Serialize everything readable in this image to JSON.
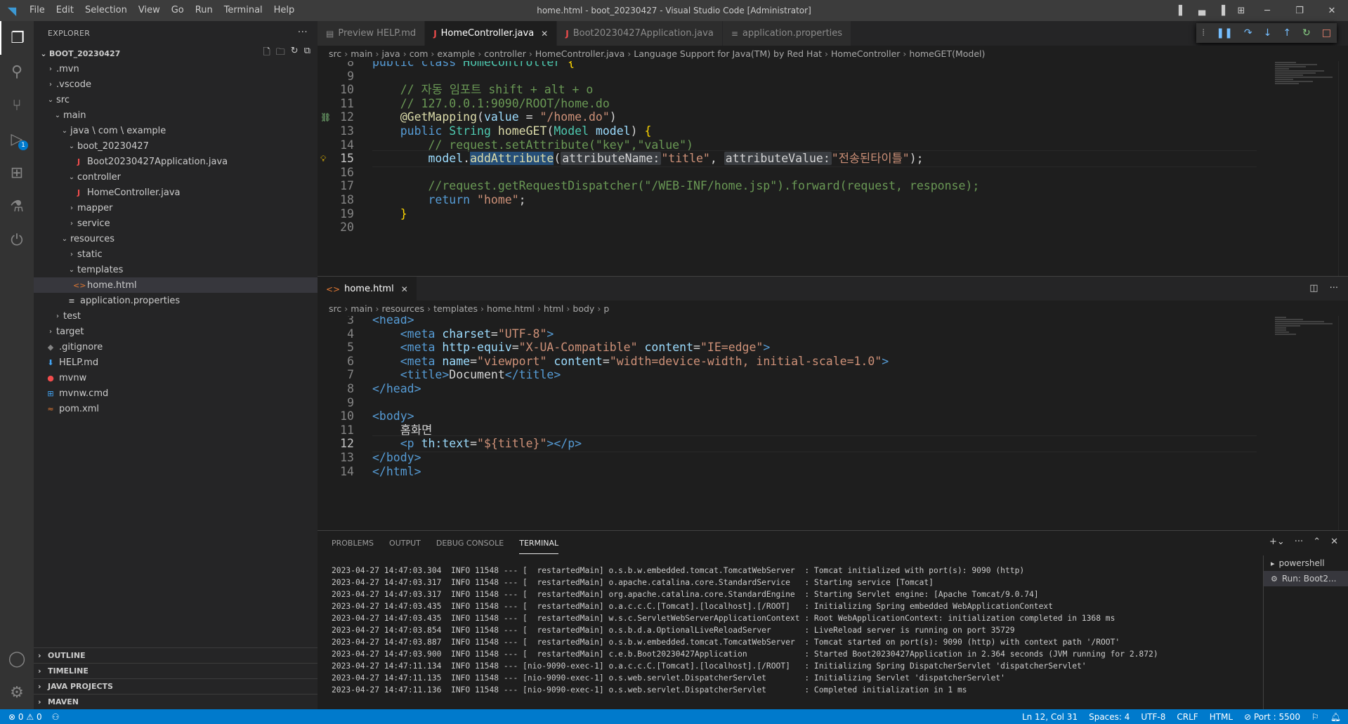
{
  "window": {
    "title": "home.html - boot_20230427 - Visual Studio Code [Administrator]",
    "menu": [
      "File",
      "Edit",
      "Selection",
      "View",
      "Go",
      "Run",
      "Terminal",
      "Help"
    ]
  },
  "activity": {
    "debug_badge": "1"
  },
  "sidebar": {
    "header": "EXPLORER",
    "root": "BOOT_20230427",
    "tree": [
      {
        "label": ".mvn",
        "depth": 1,
        "type": "folder",
        "open": false
      },
      {
        "label": ".vscode",
        "depth": 1,
        "type": "folder",
        "open": false
      },
      {
        "label": "src",
        "depth": 1,
        "type": "folder",
        "open": true
      },
      {
        "label": "main",
        "depth": 2,
        "type": "folder",
        "open": true
      },
      {
        "label": "java \\ com \\ example",
        "depth": 3,
        "type": "folder",
        "open": true
      },
      {
        "label": "boot_20230427",
        "depth": 4,
        "type": "folder",
        "open": true
      },
      {
        "label": "Boot20230427Application.java",
        "depth": 5,
        "type": "java"
      },
      {
        "label": "controller",
        "depth": 4,
        "type": "folder",
        "open": true
      },
      {
        "label": "HomeController.java",
        "depth": 5,
        "type": "java"
      },
      {
        "label": "mapper",
        "depth": 4,
        "type": "folder",
        "open": false
      },
      {
        "label": "service",
        "depth": 4,
        "type": "folder",
        "open": false
      },
      {
        "label": "resources",
        "depth": 3,
        "type": "folder",
        "open": true
      },
      {
        "label": "static",
        "depth": 4,
        "type": "folder",
        "open": false
      },
      {
        "label": "templates",
        "depth": 4,
        "type": "folder",
        "open": true
      },
      {
        "label": "home.html",
        "depth": 5,
        "type": "html",
        "selected": true
      },
      {
        "label": "application.properties",
        "depth": 4,
        "type": "prop"
      },
      {
        "label": "test",
        "depth": 2,
        "type": "folder",
        "open": false
      },
      {
        "label": "target",
        "depth": 1,
        "type": "folder",
        "open": false
      },
      {
        "label": ".gitignore",
        "depth": 1,
        "type": "git"
      },
      {
        "label": "HELP.md",
        "depth": 1,
        "type": "md"
      },
      {
        "label": "mvnw",
        "depth": 1,
        "type": "mvnw"
      },
      {
        "label": "mvnw.cmd",
        "depth": 1,
        "type": "cmd"
      },
      {
        "label": "pom.xml",
        "depth": 1,
        "type": "xml"
      }
    ],
    "sections": [
      "OUTLINE",
      "TIMELINE",
      "JAVA PROJECTS",
      "MAVEN"
    ]
  },
  "editor_top": {
    "tabs": [
      {
        "label": "Preview HELP.md",
        "icon": "preview",
        "active": false
      },
      {
        "label": "HomeController.java",
        "icon": "java",
        "active": true
      },
      {
        "label": "Boot20230427Application.java",
        "icon": "java",
        "active": false
      },
      {
        "label": "application.properties",
        "icon": "prop",
        "active": false
      }
    ],
    "breadcrumb": [
      "src",
      "main",
      "java",
      "com",
      "example",
      "controller",
      "HomeController.java",
      "Language Support for Java(TM) by Red Hat",
      "HomeController",
      "homeGET(Model)"
    ],
    "lines": [
      {
        "n": "8",
        "html": "<span class=\"kw\">public</span> <span class=\"kw\">class</span> <span class=\"ty\">HomeController</span> <span class=\"br\">{</span>"
      },
      {
        "n": "9",
        "html": ""
      },
      {
        "n": "10",
        "html": "    <span class=\"cm\">// 자동 임포트 shift + alt + o</span>"
      },
      {
        "n": "11",
        "html": "    <span class=\"cm\">// 127.0.0.1:9090/ROOT/home.do</span>"
      },
      {
        "n": "12",
        "html": "    <span class=\"an\">@GetMapping</span>(<span class=\"va\">value</span> = <span class=\"st\">\"/home.do\"</span>)"
      },
      {
        "n": "13",
        "html": "    <span class=\"kw\">public</span> <span class=\"ty\">String</span> <span class=\"fn\">homeGET</span>(<span class=\"ty\">Model</span> <span class=\"va\">model</span>) <span class=\"br\">{</span>"
      },
      {
        "n": "14",
        "html": "        <span class=\"cm\">// request.setAttribute(\"key\",\"value\")</span>"
      },
      {
        "n": "15",
        "html": "        <span class=\"va\">model</span>.<span class=\"fn fnh\">addAttribute</span>(<span class=\"ih\">attributeName:</span><span class=\"st\">\"title\"</span>, <span class=\"ih\">attributeValue:</span><span class=\"st\">\"전송된타이틀\"</span>);",
        "cur": true
      },
      {
        "n": "16",
        "html": ""
      },
      {
        "n": "17",
        "html": "        <span class=\"cm\">//request.getRequestDispatcher(\"/WEB-INF/home.jsp\").forward(request, response);</span>"
      },
      {
        "n": "18",
        "html": "        <span class=\"kw\">return</span> <span class=\"st\">\"home\"</span>;"
      },
      {
        "n": "19",
        "html": "    <span class=\"br\">}</span>"
      },
      {
        "n": "20",
        "html": ""
      }
    ]
  },
  "editor_bottom": {
    "tab": "home.html",
    "breadcrumb": [
      "src",
      "main",
      "resources",
      "templates",
      "home.html",
      "html",
      "body",
      "p"
    ],
    "lines": [
      {
        "n": "3",
        "html": "<span class=\"tg\">&lt;head&gt;</span>"
      },
      {
        "n": "4",
        "html": "    <span class=\"tg\">&lt;meta</span> <span class=\"at\">charset</span>=<span class=\"st\">\"UTF-8\"</span><span class=\"tg\">&gt;</span>"
      },
      {
        "n": "5",
        "html": "    <span class=\"tg\">&lt;meta</span> <span class=\"at\">http-equiv</span>=<span class=\"st\">\"X-UA-Compatible\"</span> <span class=\"at\">content</span>=<span class=\"st\">\"IE=edge\"</span><span class=\"tg\">&gt;</span>"
      },
      {
        "n": "6",
        "html": "    <span class=\"tg\">&lt;meta</span> <span class=\"at\">name</span>=<span class=\"st\">\"viewport\"</span> <span class=\"at\">content</span>=<span class=\"st\">\"width=device-width, initial-scale=1.0\"</span><span class=\"tg\">&gt;</span>"
      },
      {
        "n": "7",
        "html": "    <span class=\"tg\">&lt;title&gt;</span>Document<span class=\"tg\">&lt;/title&gt;</span>"
      },
      {
        "n": "8",
        "html": "<span class=\"tg\">&lt;/head&gt;</span>"
      },
      {
        "n": "9",
        "html": ""
      },
      {
        "n": "10",
        "html": "<span class=\"tg\">&lt;body&gt;</span>"
      },
      {
        "n": "11",
        "html": "    홈화면"
      },
      {
        "n": "12",
        "html": "    <span class=\"tg\">&lt;p</span> <span class=\"at\">th:text</span>=<span class=\"st\">\"${title}\"</span><span class=\"tg\">&gt;&lt;/p&gt;</span>",
        "cur": true
      },
      {
        "n": "13",
        "html": "<span class=\"tg\">&lt;/body&gt;</span>"
      },
      {
        "n": "14",
        "html": "<span class=\"tg\">&lt;/html&gt;</span>"
      }
    ]
  },
  "panel": {
    "tabs": [
      "PROBLEMS",
      "OUTPUT",
      "DEBUG CONSOLE",
      "TERMINAL"
    ],
    "active_tab": "TERMINAL",
    "terminal_lines": [
      "2023-04-27 14:47:03.304  INFO 11548 --- [  restartedMain] o.s.b.w.embedded.tomcat.TomcatWebServer  : Tomcat initialized with port(s): 9090 (http)",
      "2023-04-27 14:47:03.317  INFO 11548 --- [  restartedMain] o.apache.catalina.core.StandardService   : Starting service [Tomcat]",
      "2023-04-27 14:47:03.317  INFO 11548 --- [  restartedMain] org.apache.catalina.core.StandardEngine  : Starting Servlet engine: [Apache Tomcat/9.0.74]",
      "2023-04-27 14:47:03.435  INFO 11548 --- [  restartedMain] o.a.c.c.C.[Tomcat].[localhost].[/ROOT]   : Initializing Spring embedded WebApplicationContext",
      "2023-04-27 14:47:03.435  INFO 11548 --- [  restartedMain] w.s.c.ServletWebServerApplicationContext : Root WebApplicationContext: initialization completed in 1368 ms",
      "2023-04-27 14:47:03.854  INFO 11548 --- [  restartedMain] o.s.b.d.a.OptionalLiveReloadServer       : LiveReload server is running on port 35729",
      "2023-04-27 14:47:03.887  INFO 11548 --- [  restartedMain] o.s.b.w.embedded.tomcat.TomcatWebServer  : Tomcat started on port(s): 9090 (http) with context path '/ROOT'",
      "2023-04-27 14:47:03.900  INFO 11548 --- [  restartedMain] c.e.b.Boot20230427Application            : Started Boot20230427Application in 2.364 seconds (JVM running for 2.872)",
      "2023-04-27 14:47:11.134  INFO 11548 --- [nio-9090-exec-1] o.a.c.c.C.[Tomcat].[localhost].[/ROOT]   : Initializing Spring DispatcherServlet 'dispatcherServlet'",
      "2023-04-27 14:47:11.135  INFO 11548 --- [nio-9090-exec-1] o.s.web.servlet.DispatcherServlet        : Initializing Servlet 'dispatcherServlet'",
      "2023-04-27 14:47:11.136  INFO 11548 --- [nio-9090-exec-1] o.s.web.servlet.DispatcherServlet        : Completed initialization in 1 ms"
    ],
    "terminals": [
      "powershell",
      "Run: Boot2..."
    ]
  },
  "status": {
    "errors": "0",
    "warnings": "0",
    "position": "Ln 12, Col 31",
    "spaces": "Spaces: 4",
    "encoding": "UTF-8",
    "eol": "CRLF",
    "language": "HTML",
    "port": "Port : 5500"
  }
}
